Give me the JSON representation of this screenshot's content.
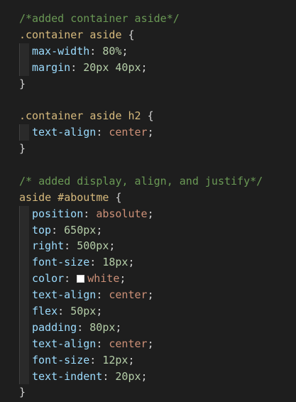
{
  "editor": {
    "lines": [
      {
        "indent": false,
        "tokens": [
          {
            "t": "comment",
            "v": "/*added container aside*/"
          }
        ]
      },
      {
        "indent": false,
        "tokens": [
          {
            "t": "selector",
            "v": ".container aside"
          },
          {
            "t": "punct",
            "v": " {"
          }
        ]
      },
      {
        "indent": true,
        "tokens": [
          {
            "t": "prop",
            "v": "max-width"
          },
          {
            "t": "punct",
            "v": ": "
          },
          {
            "t": "num",
            "v": "80%"
          },
          {
            "t": "punct",
            "v": ";"
          }
        ]
      },
      {
        "indent": true,
        "tokens": [
          {
            "t": "prop",
            "v": "margin"
          },
          {
            "t": "punct",
            "v": ": "
          },
          {
            "t": "num",
            "v": "20px 40px"
          },
          {
            "t": "punct",
            "v": ";"
          }
        ]
      },
      {
        "indent": false,
        "tokens": [
          {
            "t": "punct",
            "v": "}"
          }
        ]
      },
      {
        "indent": false,
        "tokens": []
      },
      {
        "indent": false,
        "tokens": [
          {
            "t": "selector",
            "v": ".container aside h2"
          },
          {
            "t": "punct",
            "v": " {"
          }
        ]
      },
      {
        "indent": true,
        "tokens": [
          {
            "t": "prop",
            "v": "text-align"
          },
          {
            "t": "punct",
            "v": ": "
          },
          {
            "t": "kw",
            "v": "center"
          },
          {
            "t": "punct",
            "v": ";"
          }
        ]
      },
      {
        "indent": false,
        "tokens": [
          {
            "t": "punct",
            "v": "}"
          }
        ]
      },
      {
        "indent": false,
        "tokens": []
      },
      {
        "indent": false,
        "tokens": [
          {
            "t": "comment",
            "v": "/* added display, align, and justify*/"
          }
        ]
      },
      {
        "indent": false,
        "tokens": [
          {
            "t": "selector",
            "v": "aside #aboutme"
          },
          {
            "t": "punct",
            "v": " {"
          }
        ]
      },
      {
        "indent": true,
        "tokens": [
          {
            "t": "prop",
            "v": "position"
          },
          {
            "t": "punct",
            "v": ": "
          },
          {
            "t": "kw",
            "v": "absolute"
          },
          {
            "t": "punct",
            "v": ";"
          }
        ]
      },
      {
        "indent": true,
        "tokens": [
          {
            "t": "prop",
            "v": "top"
          },
          {
            "t": "punct",
            "v": ": "
          },
          {
            "t": "num",
            "v": "650px"
          },
          {
            "t": "punct",
            "v": ";"
          }
        ]
      },
      {
        "indent": true,
        "tokens": [
          {
            "t": "prop",
            "v": "right"
          },
          {
            "t": "punct",
            "v": ": "
          },
          {
            "t": "num",
            "v": "500px"
          },
          {
            "t": "punct",
            "v": ";"
          }
        ]
      },
      {
        "indent": true,
        "tokens": [
          {
            "t": "prop",
            "v": "font-size"
          },
          {
            "t": "punct",
            "v": ": "
          },
          {
            "t": "num",
            "v": "18px"
          },
          {
            "t": "punct",
            "v": ";"
          }
        ]
      },
      {
        "indent": true,
        "tokens": [
          {
            "t": "prop",
            "v": "color"
          },
          {
            "t": "punct",
            "v": ": "
          },
          {
            "t": "swatch",
            "v": "#ffffff"
          },
          {
            "t": "kw",
            "v": "white"
          },
          {
            "t": "punct",
            "v": ";"
          }
        ]
      },
      {
        "indent": true,
        "tokens": [
          {
            "t": "prop",
            "v": "text-align"
          },
          {
            "t": "punct",
            "v": ": "
          },
          {
            "t": "kw",
            "v": "center"
          },
          {
            "t": "punct",
            "v": ";"
          }
        ]
      },
      {
        "indent": true,
        "tokens": [
          {
            "t": "prop",
            "v": "flex"
          },
          {
            "t": "punct",
            "v": ": "
          },
          {
            "t": "num",
            "v": "50px"
          },
          {
            "t": "punct",
            "v": ";"
          }
        ]
      },
      {
        "indent": true,
        "tokens": [
          {
            "t": "prop",
            "v": "padding"
          },
          {
            "t": "punct",
            "v": ": "
          },
          {
            "t": "num",
            "v": "80px"
          },
          {
            "t": "punct",
            "v": ";"
          }
        ]
      },
      {
        "indent": true,
        "tokens": [
          {
            "t": "prop",
            "v": "text-align"
          },
          {
            "t": "punct",
            "v": ": "
          },
          {
            "t": "kw",
            "v": "center"
          },
          {
            "t": "punct",
            "v": ";"
          }
        ]
      },
      {
        "indent": true,
        "tokens": [
          {
            "t": "prop",
            "v": "font-size"
          },
          {
            "t": "punct",
            "v": ": "
          },
          {
            "t": "num",
            "v": "12px"
          },
          {
            "t": "punct",
            "v": ";"
          }
        ]
      },
      {
        "indent": true,
        "tokens": [
          {
            "t": "prop",
            "v": "text-indent"
          },
          {
            "t": "punct",
            "v": ": "
          },
          {
            "t": "num",
            "v": "20px"
          },
          {
            "t": "punct",
            "v": ";"
          }
        ]
      },
      {
        "indent": false,
        "tokens": [
          {
            "t": "punct",
            "v": "}"
          }
        ]
      }
    ]
  },
  "theme": {
    "background": "#1e1e1e",
    "comment": "#6a9955",
    "selector": "#d7ba7d",
    "property": "#9cdcfe",
    "number": "#b5cea8",
    "keyword": "#ce9178",
    "punctuation": "#d4d4d4"
  }
}
